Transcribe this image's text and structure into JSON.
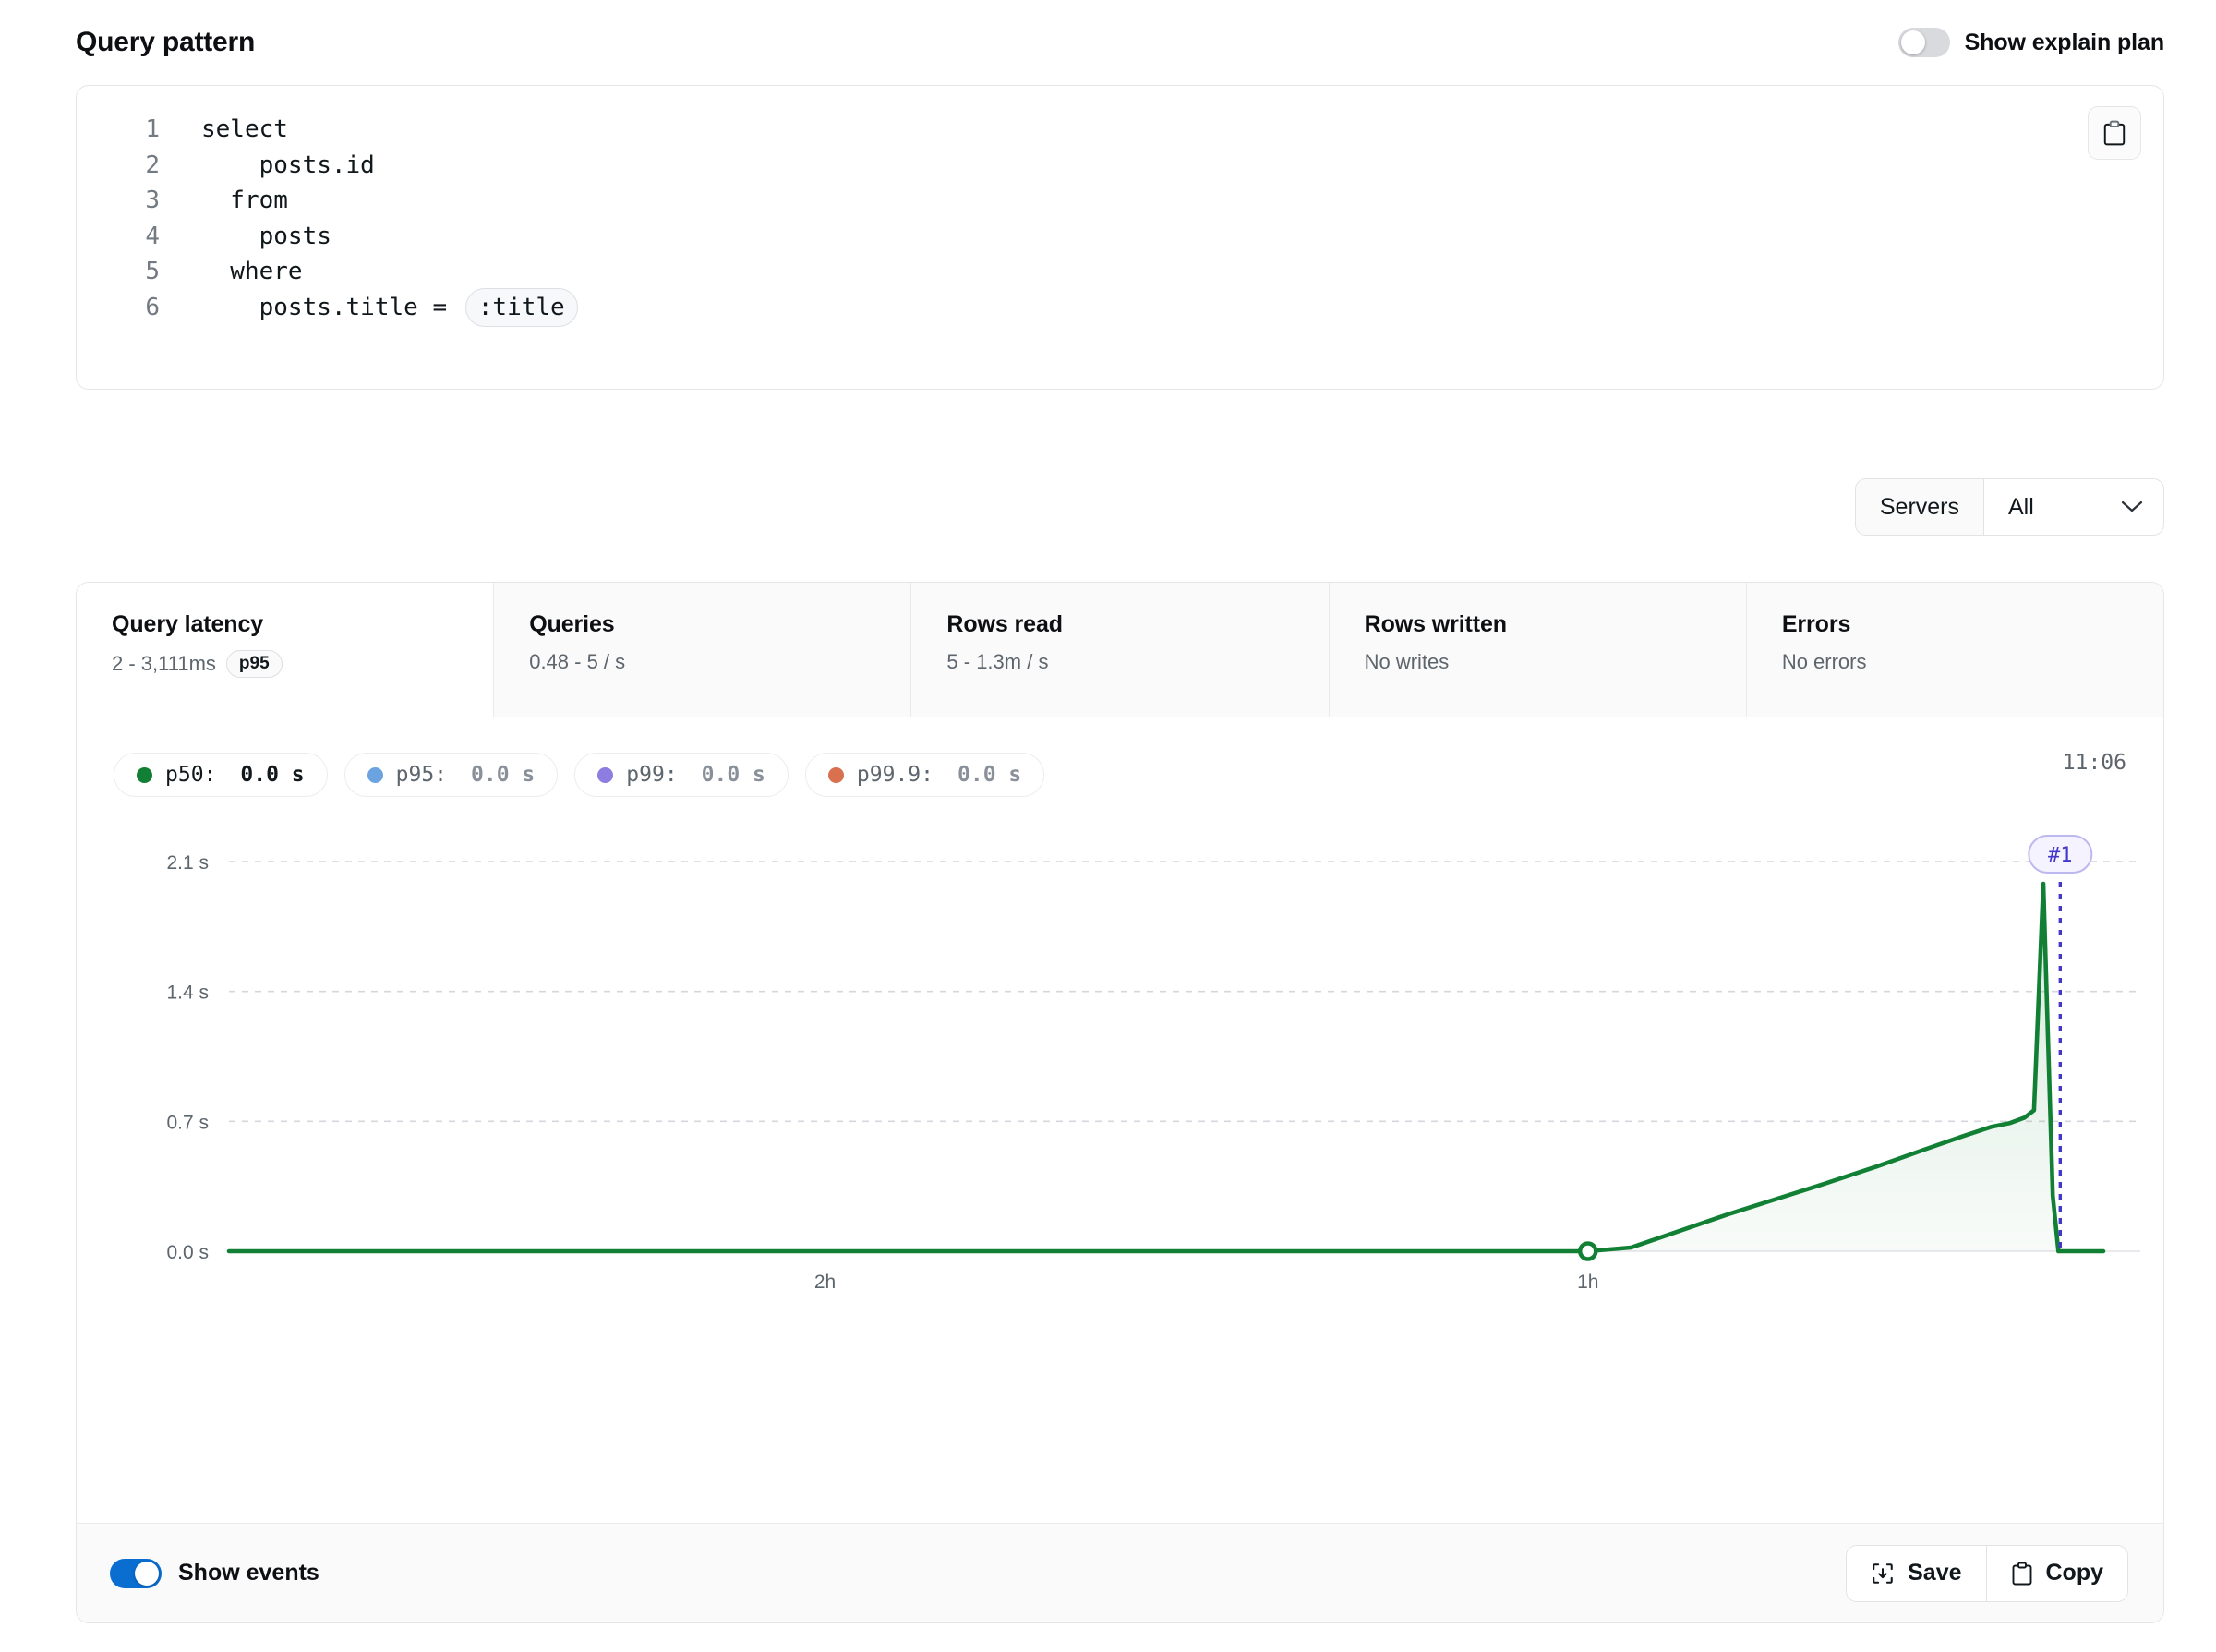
{
  "header": {
    "title": "Query pattern",
    "explain_plan_label": "Show explain plan",
    "explain_plan_on": false
  },
  "code": {
    "lines": [
      {
        "no": "1",
        "text": "select"
      },
      {
        "no": "2",
        "text": "    posts.id"
      },
      {
        "no": "3",
        "text": "  from"
      },
      {
        "no": "4",
        "text": "    posts"
      },
      {
        "no": "5",
        "text": "  where"
      },
      {
        "no": "6",
        "text": "    posts.title = "
      }
    ],
    "param_chip": ":title",
    "copy_icon": "clipboard-icon"
  },
  "servers": {
    "label": "Servers",
    "value": "All",
    "chevron_icon": "chevron-down-icon"
  },
  "tabs": [
    {
      "label": "Query latency",
      "sub": "2 - 3,111ms",
      "badge": "p95",
      "active": true
    },
    {
      "label": "Queries",
      "sub": "0.48 - 5 / s",
      "badge": "",
      "active": false
    },
    {
      "label": "Rows read",
      "sub": "5 - 1.3m / s",
      "badge": "",
      "active": false
    },
    {
      "label": "Rows written",
      "sub": "No writes",
      "badge": "",
      "active": false
    },
    {
      "label": "Errors",
      "sub": "No errors",
      "badge": "",
      "active": false
    }
  ],
  "legend": {
    "items": [
      {
        "name": "p50:",
        "value": "0.0 s",
        "color": "#128034",
        "active": true
      },
      {
        "name": "p95:",
        "value": "0.0 s",
        "color": "#6ba3e0",
        "active": false
      },
      {
        "name": "p99:",
        "value": "0.0 s",
        "color": "#8d7de0",
        "active": false
      },
      {
        "name": "p99.9:",
        "value": "0.0 s",
        "color": "#d9704f",
        "active": false
      }
    ],
    "clock": "11:06"
  },
  "footer": {
    "events_label": "Show events",
    "events_on": true,
    "save_label": "Save",
    "save_icon": "save-download-icon",
    "copy_label": "Copy",
    "copy_icon": "clipboard-icon"
  },
  "chart_data": {
    "type": "area",
    "title": "Query latency",
    "xlabel": "",
    "ylabel": "",
    "ylim": [
      0.0,
      2.1
    ],
    "yticks": [
      "0.0 s",
      "0.7 s",
      "1.4 s",
      "2.1 s"
    ],
    "ytick_values": [
      0.0,
      0.7,
      1.4,
      2.1
    ],
    "xticks": [
      "2h",
      "1h"
    ],
    "xtick_positions": [
      0.318,
      0.725
    ],
    "grid": true,
    "legend_position": "top-left",
    "line_color": "#128034",
    "fill_color": "#e8f6ec",
    "series": [
      {
        "name": "p50",
        "color": "#128034",
        "points": [
          {
            "x": 0.0,
            "y": 0.0
          },
          {
            "x": 0.6,
            "y": 0.0
          },
          {
            "x": 0.725,
            "y": 0.0
          },
          {
            "x": 0.748,
            "y": 0.02
          },
          {
            "x": 0.8,
            "y": 0.2
          },
          {
            "x": 0.85,
            "y": 0.36
          },
          {
            "x": 0.88,
            "y": 0.46
          },
          {
            "x": 0.905,
            "y": 0.55
          },
          {
            "x": 0.925,
            "y": 0.62
          },
          {
            "x": 0.94,
            "y": 0.67
          },
          {
            "x": 0.95,
            "y": 0.69
          },
          {
            "x": 0.958,
            "y": 0.72
          },
          {
            "x": 0.963,
            "y": 0.76
          },
          {
            "x": 0.968,
            "y": 1.98
          },
          {
            "x": 0.973,
            "y": 0.3
          },
          {
            "x": 0.976,
            "y": 0.0
          },
          {
            "x": 1.0,
            "y": 0.0
          }
        ]
      }
    ],
    "markers": [
      {
        "name": "p50-start-point",
        "x": 0.725,
        "y": 0.0,
        "style": "hollow-circle"
      }
    ],
    "annotations": [
      {
        "label": "#1",
        "x": 0.977,
        "type": "event-marker",
        "color": "#4338ca"
      }
    ]
  }
}
